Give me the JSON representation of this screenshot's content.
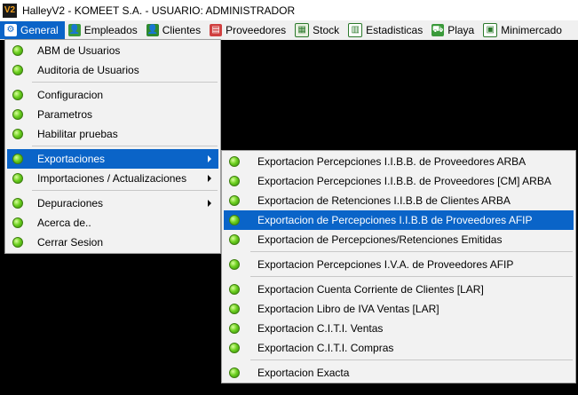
{
  "window": {
    "logo_text": "V2",
    "title": "HalleyV2 - KOMEET S.A. - USUARIO: ADMINISTRADOR"
  },
  "menubar": {
    "items": [
      {
        "label": "General",
        "icon": "gear-icon",
        "active": true
      },
      {
        "label": "Empleados",
        "icon": "employee-icon"
      },
      {
        "label": "Clientes",
        "icon": "client-icon"
      },
      {
        "label": "Proveedores",
        "icon": "supplier-icon"
      },
      {
        "label": "Stock",
        "icon": "stock-icon"
      },
      {
        "label": "Estadisticas",
        "icon": "statistics-icon"
      },
      {
        "label": "Playa",
        "icon": "truck-icon"
      },
      {
        "label": "Minimercado",
        "icon": "minimarket-icon"
      }
    ]
  },
  "general_menu": {
    "items": [
      "ABM de Usuarios",
      "Auditoria de Usuarios",
      "Configuracion",
      "Parametros",
      "Habilitar pruebas",
      "Exportaciones",
      "Importaciones / Actualizaciones",
      "Depuraciones",
      "Acerca de..",
      "Cerrar Sesion"
    ]
  },
  "export_menu": {
    "items": [
      "Exportacion Percepciones I.I.B.B. de Proveedores ARBA",
      "Exportacion Percepciones I.I.B.B. de Proveedores [CM] ARBA",
      "Exportacion de Retenciones I.I.B.B de Clientes ARBA",
      "Exportacion de Percepciones I.I.B.B de Proveedores AFIP",
      "Exportacion de Percepciones/Retenciones Emitidas",
      "Exportacion Percepciones I.V.A. de Proveedores AFIP",
      "Exportacion Cuenta Corriente de Clientes [LAR]",
      "Exportacion Libro de IVA Ventas [LAR]",
      "Exportacion C.I.T.I. Ventas",
      "Exportacion C.I.T.I. Compras",
      "Exportacion Exacta"
    ]
  },
  "colors": {
    "highlight": "#0a64c8",
    "menu_bg": "#f2f2f2",
    "status_dot": "#6ed020"
  }
}
